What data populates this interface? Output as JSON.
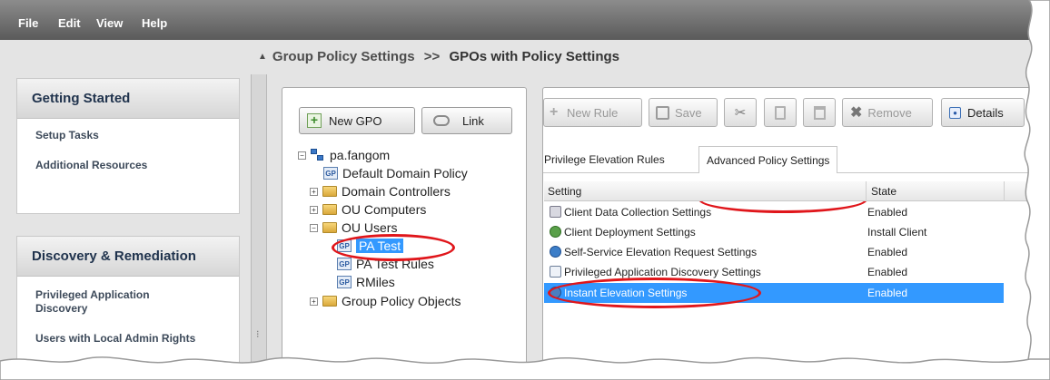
{
  "menubar": {
    "items": [
      "File",
      "Edit",
      "View",
      "Help"
    ]
  },
  "breadcrumb": {
    "parent": "Group Policy Settings",
    "separator": ">>",
    "current": "GPOs with Policy Settings"
  },
  "sidebar": {
    "sections": [
      {
        "title": "Getting Started",
        "items": [
          "Setup Tasks",
          "Additional Resources"
        ]
      },
      {
        "title": "Discovery & Remediation",
        "items": [
          "Privileged Application Discovery",
          "Users with Local Admin Rights"
        ]
      }
    ]
  },
  "tree_panel": {
    "buttons": {
      "new_gpo": "New GPO",
      "link": "Link"
    },
    "nodes": [
      "pa.fangom",
      "Default Domain Policy",
      "Domain Controllers",
      "OU Computers",
      "OU Users",
      "PA Test",
      "PA Test Rules",
      "RMiles",
      "Group Policy Objects"
    ],
    "selected": "PA Test"
  },
  "right_panel": {
    "toolbar": {
      "new_rule": "New Rule",
      "save": "Save",
      "remove": "Remove",
      "details": "Details"
    },
    "tabs": [
      "Privilege Elevation Rules",
      "Advanced Policy Settings"
    ],
    "active_tab": "Advanced Policy Settings",
    "grid": {
      "columns": [
        "Setting",
        "State"
      ],
      "rows": [
        {
          "setting": "Client Data Collection Settings",
          "state": "Enabled"
        },
        {
          "setting": "Client Deployment Settings",
          "state": "Install Client"
        },
        {
          "setting": "Self-Service Elevation Request Settings",
          "state": "Enabled"
        },
        {
          "setting": "Privileged Application Discovery Settings",
          "state": "Enabled"
        },
        {
          "setting": "Instant Elevation Settings",
          "state": "Enabled"
        }
      ],
      "selected": "Instant Elevation Settings"
    }
  },
  "colors": {
    "selection": "#3399ff",
    "callout": "#e0161b",
    "menubar": "#6e6e6e",
    "nav_heading": "#20334d"
  },
  "icons": [
    "plus-icon",
    "chain-link-icon",
    "domain-icon",
    "gpo-icon",
    "folder-icon",
    "save-disk-icon",
    "scissors-icon",
    "copy-icon",
    "paste-icon",
    "remove-x-icon",
    "details-icon",
    "settings-row-icon"
  ]
}
